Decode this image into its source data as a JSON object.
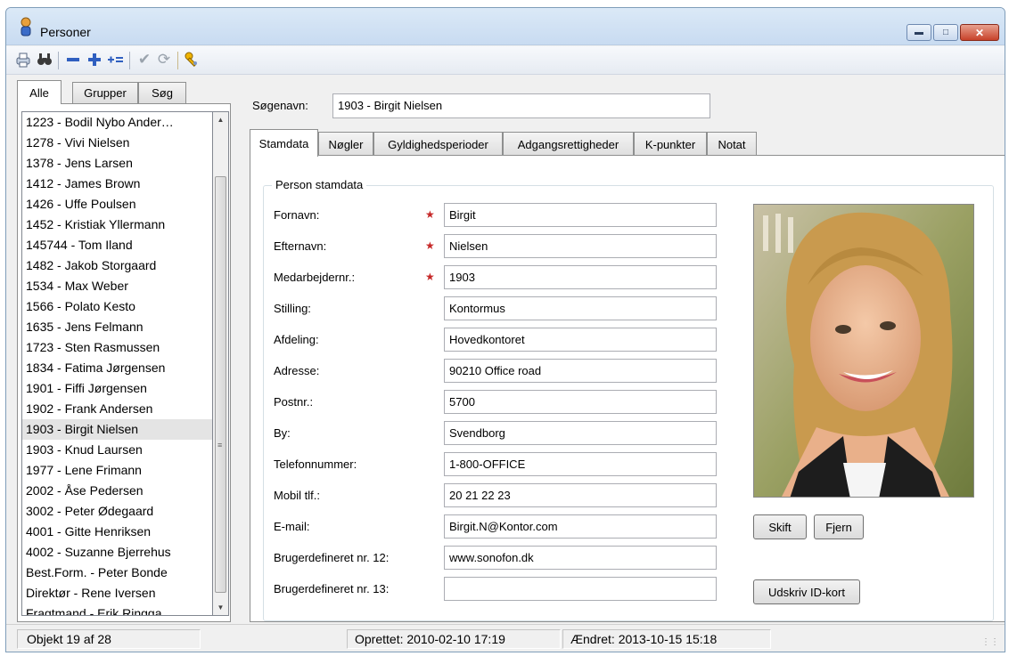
{
  "window": {
    "title": "Personer"
  },
  "toolbar": {
    "icons": [
      "print-icon",
      "find-icon",
      "remove-icon",
      "add-icon",
      "add-multiple-icon",
      "confirm-icon",
      "refresh-icon",
      "keys-icon"
    ]
  },
  "left_tabs": [
    "Alle",
    "Grupper",
    "Søg"
  ],
  "people": [
    "1223 - Bodil Nybo Ander…",
    "1278 - Vivi Nielsen",
    "1378 - Jens Larsen",
    "1412 - James Brown",
    "1426 - Uffe Poulsen",
    "1452 - Kristiak Yllermann",
    "145744 - Tom Iland",
    "1482 - Jakob Storgaard",
    "1534 - Max Weber",
    "1566 - Polato Kesto",
    "1635 - Jens Felmann",
    "1723 - Sten Rasmussen",
    "1834 - Fatima Jørgensen",
    "1901 - Fiffi Jørgensen",
    "1902 - Frank Andersen",
    "1903 - Birgit Nielsen",
    "1903 - Knud Laursen",
    "1977 - Lene Frimann",
    "2002 - Åse Pedersen",
    "3002 - Peter Ødegaard",
    "4001 - Gitte Henriksen",
    "4002 - Suzanne Bjerrehus",
    "Best.Form. - Peter Bonde",
    "Direktør - Rene Iversen",
    "Fragtmand - Erik Ringga…"
  ],
  "selected_person": "1903 - Birgit Nielsen",
  "search": {
    "label": "Søgenavn:",
    "value": "1903 - Birgit Nielsen"
  },
  "tabs": [
    "Stamdata",
    "Nøgler",
    "Gyldighedsperioder",
    "Adgangsrettigheder",
    "K-punkter",
    "Notat"
  ],
  "group_title": "Person stamdata",
  "required_mark": "★",
  "fields": [
    {
      "label": "Fornavn:",
      "value": "Birgit",
      "required": true
    },
    {
      "label": "Efternavn:",
      "value": "Nielsen",
      "required": true
    },
    {
      "label": "Medarbejdernr.:",
      "value": "1903",
      "required": true
    },
    {
      "label": "Stilling:",
      "value": "Kontormus",
      "required": false
    },
    {
      "label": "Afdeling:",
      "value": "Hovedkontoret",
      "required": false
    },
    {
      "label": "Adresse:",
      "value": "90210 Office road",
      "required": false
    },
    {
      "label": "Postnr.:",
      "value": "5700",
      "required": false
    },
    {
      "label": "By:",
      "value": "Svendborg",
      "required": false
    },
    {
      "label": "Telefonnummer:",
      "value": "1-800-OFFICE",
      "required": false
    },
    {
      "label": "Mobil tlf.:",
      "value": "20 21 22 23",
      "required": false
    },
    {
      "label": "E-mail:",
      "value": "Birgit.N@Kontor.com",
      "required": false
    },
    {
      "label": "Brugerdefineret nr. 12:",
      "value": "www.sonofon.dk",
      "required": false
    },
    {
      "label": "Brugerdefineret nr. 13:",
      "value": "",
      "required": false
    }
  ],
  "buttons": {
    "change": "Skift",
    "remove": "Fjern",
    "print_id": "Udskriv ID-kort"
  },
  "status": {
    "object": "Objekt 19 af 28",
    "created": "Oprettet: 2010-02-10  17:19",
    "changed": "Ændret: 2013-10-15  15:18"
  },
  "colors": {
    "title_gradient": "#c8dbf1",
    "close_button": "#c7422a",
    "required": "#c62828",
    "selection": "#e4e4e4"
  }
}
